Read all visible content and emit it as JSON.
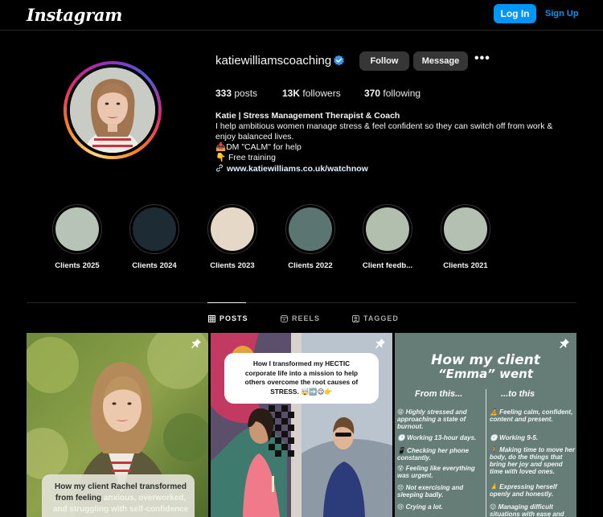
{
  "app": {
    "logo": "Instagram"
  },
  "topbar": {
    "login_label": "Log In",
    "signup_label": "Sign Up"
  },
  "profile": {
    "username": "katiewilliamscoaching",
    "follow_label": "Follow",
    "message_label": "Message",
    "more_label": "•••",
    "stats": {
      "posts_count": "333",
      "posts_label": "posts",
      "followers_count": "13K",
      "followers_label": "followers",
      "following_count": "370",
      "following_label": "following"
    },
    "bio": {
      "name": "Katie | Stress Management Therapist & Coach",
      "line1": "I help ambitious women manage stress & feel confident so they can switch off from work &",
      "line2": "enjoy balanced lives.",
      "line3": "📥DM \"CALM\" for help",
      "line4": "👇 Free training",
      "link": "www.katiewilliams.co.uk/watchnow"
    }
  },
  "highlights": [
    {
      "label": "Clients 2025",
      "color": "#b7c3b7"
    },
    {
      "label": "Clients 2024",
      "color": "#1d2b35"
    },
    {
      "label": "Clients 2023",
      "color": "#e5d8c6"
    },
    {
      "label": "Clients 2022",
      "color": "#5a7572"
    },
    {
      "label": "Client feedb...",
      "color": "#b2bfaf"
    },
    {
      "label": "Clients 2021",
      "color": "#b4c1b2"
    }
  ],
  "tabs": [
    {
      "label": "POSTS",
      "icon": "grid-icon"
    },
    {
      "label": "REELS",
      "icon": "reels-icon"
    },
    {
      "label": "TAGGED",
      "icon": "tagged-icon"
    }
  ],
  "posts": {
    "post1": {
      "caption_l1_a": "How my client Rachel transformed",
      "caption_l2_a": "from feeling ",
      "caption_l2_b": "anxious, overworked,",
      "caption_l3_a": "and struggling with self-confidence"
    },
    "post2": {
      "l1": "How I transformed my HECTIC",
      "l2": "corporate life into a mission to help",
      "l3": "others overcome the root causes of",
      "l4": "STRESS. 🤯➡️😌👉"
    },
    "post3": {
      "title1": "How my client",
      "title2": "“Emma” went",
      "col_left": "From this...",
      "col_right": "...to this",
      "left_items": [
        "😫 Highly stressed and approaching a state of burnout.",
        "🕑 Working 13-hour days.",
        "📱 Checking her phone constantly.",
        "😵 Feeling like everything was urgent.",
        "😣 Not exercising and sleeping badly.",
        "😢 Crying a lot."
      ],
      "right_items": [
        "🧘 Feeling calm, confident, content and present.",
        "🕘 Working 9-5.",
        "🚶 Making time to move her body, do the things that bring her joy and spend time with loved ones.",
        "🙏 Expressing herself openly and honestly.",
        "😌 Managing difficult situations with ease and"
      ]
    }
  },
  "colors": {
    "accent": "#0095f6",
    "button_dark": "#363636",
    "post3_bg": "#667d77"
  }
}
